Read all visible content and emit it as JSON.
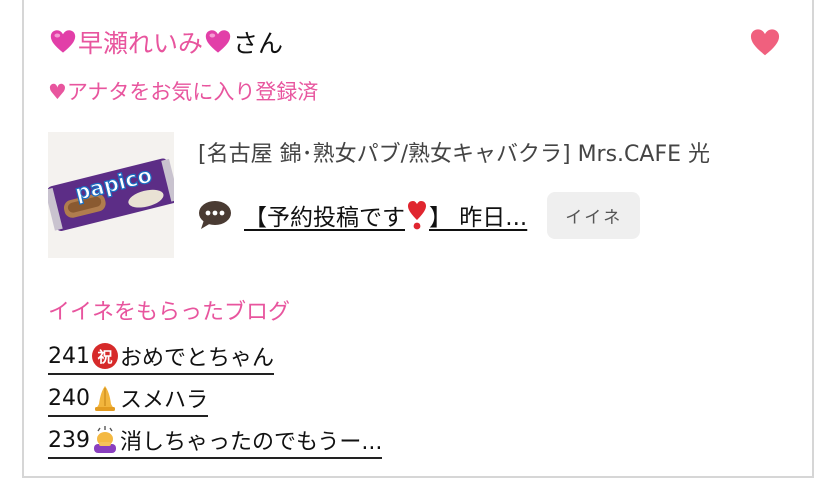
{
  "user": {
    "name": "早瀬れいみ",
    "suffix": "さん",
    "favorite_note": "♥アナタをお気に入り登録済"
  },
  "post": {
    "shop": "[名古屋 錦･熟女パブ/熟女キャバクラ]  Mrs.CAFE 光",
    "title_before": "【予約投稿です",
    "title_after": "】 昨日...",
    "iine_label": "イイネ",
    "thumb_text": "papico"
  },
  "received": {
    "heading": "イイネをもらったブログ",
    "items": [
      {
        "num": "241",
        "text": "おめでとちゃん",
        "icon": "congratulation-ideograph-icon"
      },
      {
        "num": "240",
        "text": "スメハラ",
        "icon": "folded-hands-icon"
      },
      {
        "num": "239",
        "text": "消しちゃったのでもうー...",
        "icon": "person-bowing-icon"
      }
    ]
  },
  "colors": {
    "pink": "#e8559e",
    "heart": "#f0607e"
  }
}
